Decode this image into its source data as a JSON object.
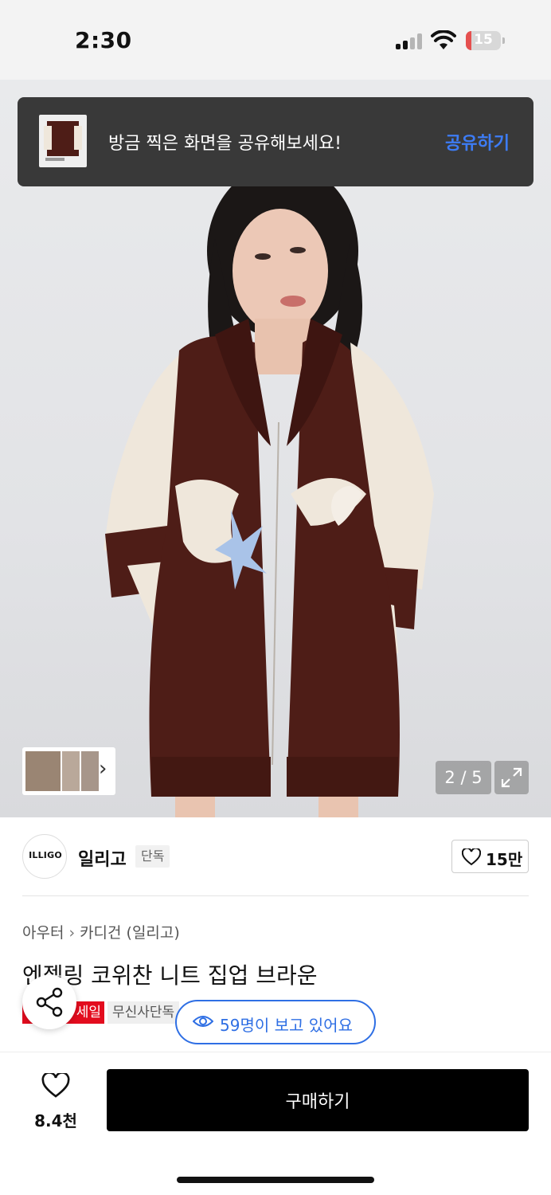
{
  "status_bar": {
    "time": "2:30",
    "battery": "15",
    "battery_level": 0.15
  },
  "toast": {
    "message": "방금 찍은 화면을 공유해보세요!",
    "action": "공유하기"
  },
  "gallery": {
    "pager": "2 / 5"
  },
  "brand": {
    "logo_text": "ILLIGO",
    "name": "일리고",
    "badge": "단독",
    "likes": "15만"
  },
  "breadcrumb": {
    "category": "아우터",
    "subcategory": "카디건 (일리고)"
  },
  "product": {
    "title": "엔젤링 코위찬 니트 집업 브라운",
    "sale_tag": "세일",
    "exclusive_tag": "무신사단독"
  },
  "viewers": {
    "text": "59명이 보고 있어요"
  },
  "bottom_bar": {
    "wishlist_count": "8.4천",
    "buy_label": "구매하기"
  },
  "colors": {
    "accent_blue": "#2f6fe4",
    "toast_action": "#3d7cf5",
    "sale_red": "#e30c1e",
    "cardigan_brown": "#4e1d17",
    "sleeve_cream": "#efe7db"
  }
}
